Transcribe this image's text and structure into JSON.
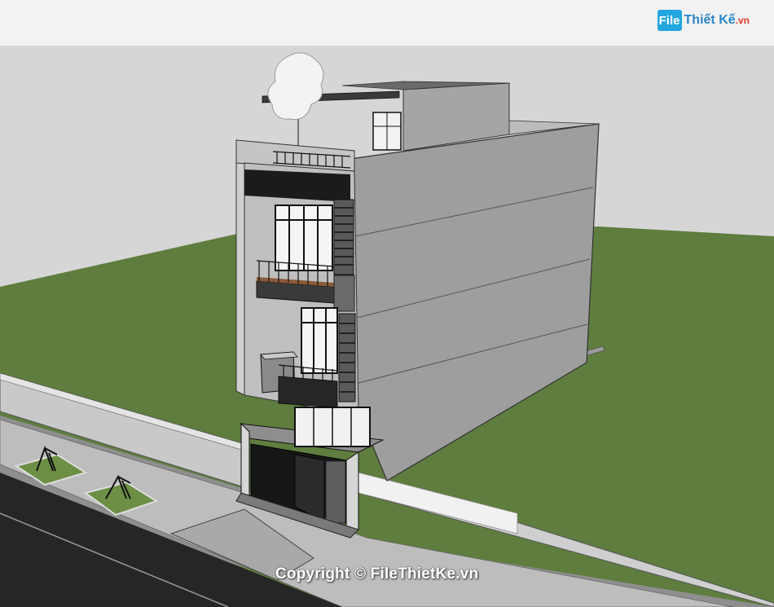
{
  "header": {
    "logo_box": "File",
    "logo_name": "Thiết Kế",
    "logo_tld": ".vn"
  },
  "watermark": "Copyright © FileThietKe.vn",
  "colors": {
    "sky": "#d8d8d8",
    "grass": "#5e7d3f",
    "wall_light": "#b4b4b4",
    "wall_side": "#9c9c9c",
    "pavement": "#c4c4c4",
    "road": "#2b2b2b",
    "accent_logo": "#23a6e0"
  },
  "icons": [
    "tree-icon",
    "swing-icon"
  ]
}
